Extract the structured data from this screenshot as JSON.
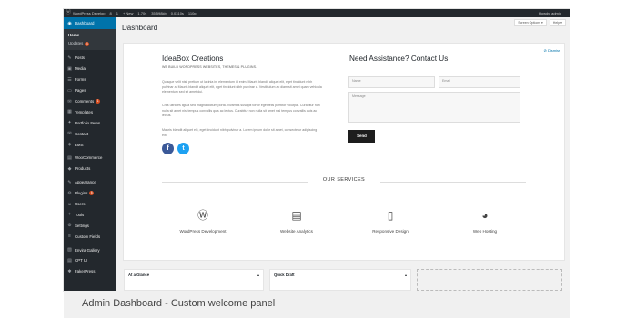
{
  "admin_bar": {
    "items": [
      "WordPress Develop",
      "8",
      "1",
      "+ New",
      "1.70s",
      "35,598kb",
      "0.0310s",
      "110q"
    ],
    "howdy": "Howdy, admin"
  },
  "sidebar": {
    "active": "Dashboard",
    "submenu": [
      "Home",
      "Updates"
    ],
    "updates_badge": "4",
    "groups": [
      [
        {
          "label": "Posts",
          "icon": "pin-icon"
        },
        {
          "label": "Media",
          "icon": "media-icon"
        },
        {
          "label": "Forms",
          "icon": "forms-icon"
        },
        {
          "label": "Pages",
          "icon": "pages-icon"
        },
        {
          "label": "Comments",
          "icon": "comments-icon",
          "badge": "1"
        },
        {
          "label": "Templates",
          "icon": "templates-icon"
        },
        {
          "label": "Portfolio Items",
          "icon": "portfolio-icon"
        },
        {
          "label": "Contact",
          "icon": "contact-icon"
        },
        {
          "label": "EMS",
          "icon": "ems-icon"
        }
      ],
      [
        {
          "label": "WooCommerce",
          "icon": "woocommerce-icon"
        },
        {
          "label": "Products",
          "icon": "products-icon"
        }
      ],
      [
        {
          "label": "Appearance",
          "icon": "appearance-icon"
        },
        {
          "label": "Plugins",
          "icon": "plugins-icon",
          "badge": "6"
        },
        {
          "label": "Users",
          "icon": "users-icon"
        },
        {
          "label": "Tools",
          "icon": "tools-icon"
        },
        {
          "label": "Settings",
          "icon": "settings-icon"
        },
        {
          "label": "Custom Fields",
          "icon": "custom-fields-icon"
        }
      ],
      [
        {
          "label": "Envira Gallery",
          "icon": "gallery-icon"
        },
        {
          "label": "CPT UI",
          "icon": "cpt-icon"
        },
        {
          "label": "FakerPress",
          "icon": "fakerpress-icon"
        }
      ]
    ]
  },
  "header": {
    "title": "Dashboard",
    "screen_options": "Screen Options ▾",
    "help": "Help ▾"
  },
  "welcome": {
    "dismiss": "⊘ Dismiss",
    "brand": "IdeaBox Creations",
    "tagline": "WE BUILD WORDPRESS WEBSITES, THEMES & PLUGINS.",
    "paragraphs": [
      "Quisque velit nisi, pretium ut lacinia in, elementum id enim. Mauris blandit aliquet elit, eget tincidunt nibh pulvinar a. Mauris blandit aliquet elit, eget tincidunt nibh pulvinar a. Vestibulum ac diam sit amet quam vehicula elementum sed sit amet dui.",
      "Cras ultricies ligula sed magna dictum porta. Vivamus suscipit tortor eget felis porttitor volutpat. Curabitur non nulla sit amet nisl tempus convallis quis ac lectus. Curabitur non nulla sit amet nisl tempus convallis quis ac lectus.",
      "Mauris blandit aliquet elit, eget tincidunt nibh pulvinar a. Lorem ipsum dolor sit amet, consectetur adipiscing elit."
    ],
    "contact_title": "Need Assistance? Contact Us.",
    "name_placeholder": "Name",
    "email_placeholder": "Email",
    "message_placeholder": "Message",
    "send_label": "Send",
    "services_title": "OUR SERVICES",
    "services": [
      {
        "label": "WordPress Development",
        "icon": "wordpress-icon"
      },
      {
        "label": "Website Analytics",
        "icon": "analytics-icon"
      },
      {
        "label": "Responsive Design",
        "icon": "tablet-icon"
      },
      {
        "label": "Web Hosting",
        "icon": "globe-icon"
      }
    ]
  },
  "widgets": {
    "at_a_glance": "At a Glance",
    "quick_draft": "Quick Draft"
  },
  "caption": "Admin Dashboard - Custom welcome panel",
  "colors": {
    "accent": "#0073aa",
    "sidebar": "#23282d",
    "badge": "#d54e21"
  }
}
